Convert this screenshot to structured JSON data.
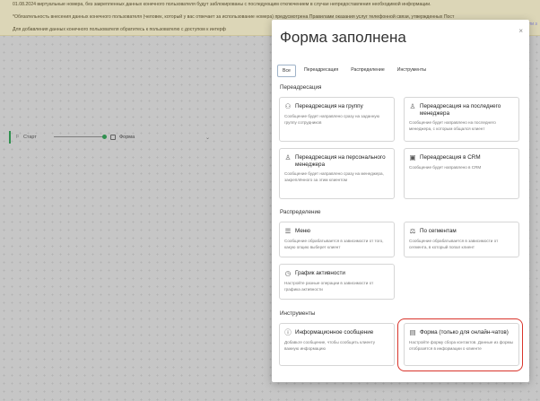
{
  "banner": {
    "line1": "01.08.2024 виртуальные номера, без закрепленных данных конечного пользователя будут заблокированы с последующим отключением в случае непредоставления необходимой информации.",
    "line2": "*Обязательность внесения данных конечного пользователя (человек, который у вас отвечает за использование номера) предусмотрена Правилами оказания услуг телефонной связи, утвержденных Пост",
    "line3": "Для добавления данных конечного пользователя обратитесь к пользователю с доступом к интерф",
    "right_link": "ти з"
  },
  "flow": {
    "start_label": "Старт",
    "node_label": "Форма"
  },
  "modal": {
    "title": "Форма заполнена",
    "close": "×",
    "tabs": [
      {
        "label": "Все",
        "active": true
      },
      {
        "label": "Переадресация",
        "active": false
      },
      {
        "label": "Распределение",
        "active": false
      },
      {
        "label": "Инструменты",
        "active": false
      }
    ],
    "sections": {
      "redirect": "Переадресация",
      "distribution": "Распределение",
      "tools": "Инструменты"
    },
    "cards": {
      "group": {
        "icon": "users-icon",
        "title": "Переадресация на группу",
        "desc": "Сообщение будет направлено сразу на заданную группу сотрудников"
      },
      "last_manager": {
        "icon": "user-icon",
        "title": "Переадресация на последнего менеджера",
        "desc": "Сообщение будет направлено на последнего менеджера, с которым общался клиент"
      },
      "personal_manager": {
        "icon": "user-check-icon",
        "title": "Переадресация на персонального менеджера",
        "desc": "Сообщение будет направлено сразу на менеджера, закреплённого за этим клиентом"
      },
      "crm": {
        "icon": "crm-icon",
        "title": "Переадресация в CRM",
        "desc": "Сообщение будет направлено в CRM"
      },
      "menu": {
        "icon": "menu-icon",
        "title": "Меню",
        "desc": "Сообщение обрабатывается в зависимости от того, какую опцию выберет клиент"
      },
      "segments": {
        "icon": "segments-icon",
        "title": "По сегментам",
        "desc": "Сообщение обрабатывается в зависимости от сегмента, в который попал клиент"
      },
      "schedule": {
        "icon": "clock-icon",
        "title": "График активности",
        "desc": "Настройте разные операции в зависимости от графика активности"
      },
      "info_message": {
        "icon": "info-message-icon",
        "title": "Информационное сообщение",
        "desc": "Добавьте сообщение, чтобы сообщить клиенту важную информацию"
      },
      "form": {
        "icon": "form-icon",
        "title": "Форма (только для онлайн-чатов)",
        "desc": "Настройте форму сбора контактов. Данные из формы отобразятся в информации о клиенте"
      }
    }
  },
  "colors": {
    "accent_green": "#2f9d53",
    "highlight_red": "#d9342b",
    "banner_bg": "#f3ecc9"
  }
}
